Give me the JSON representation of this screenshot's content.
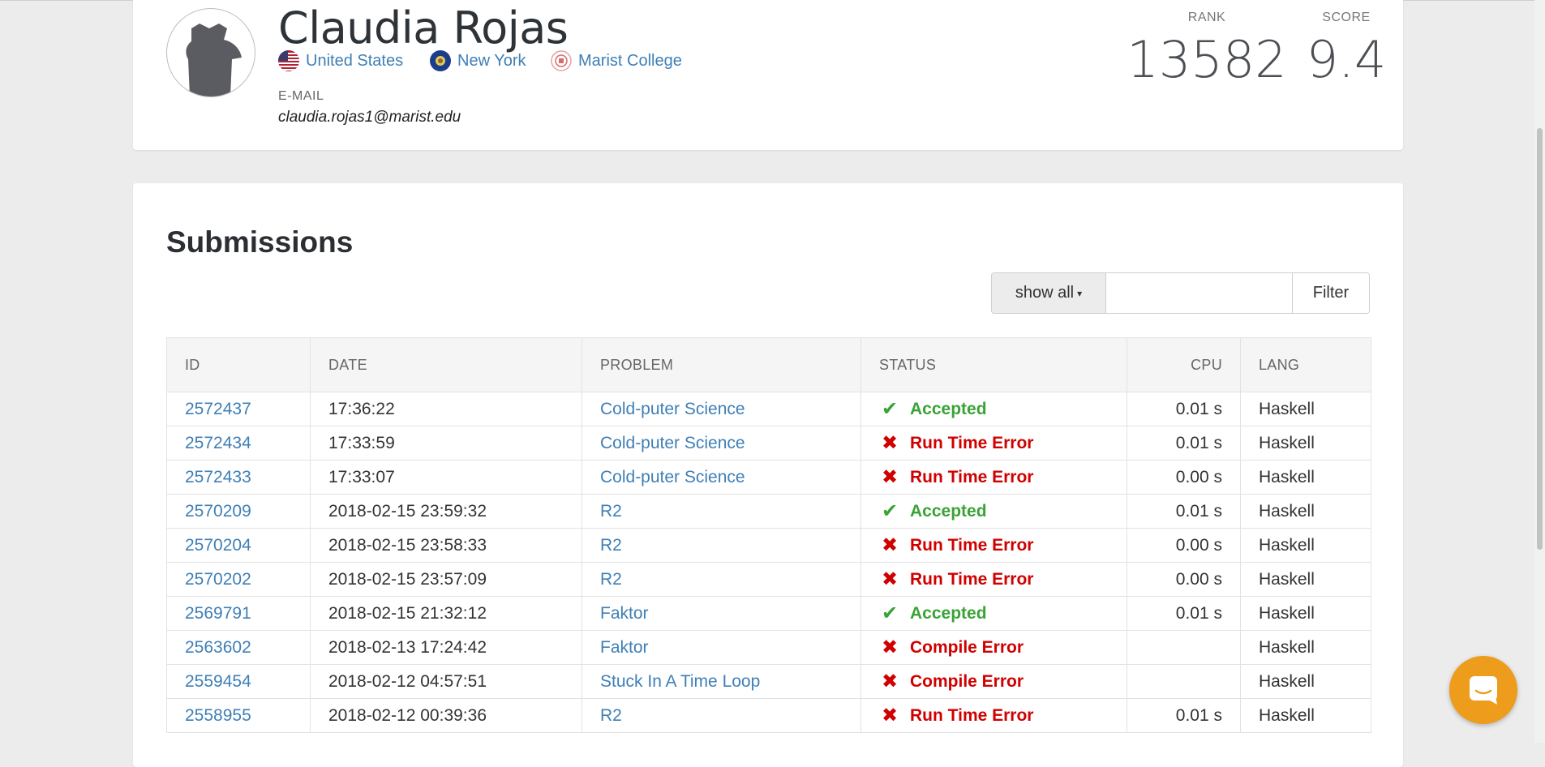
{
  "profile": {
    "name": "Claudia Rojas",
    "country": "United States",
    "state": "New York",
    "school": "Marist College",
    "email_label": "E-MAIL",
    "email": "claudia.rojas1@marist.edu",
    "rank_label": "RANK",
    "rank": "13582",
    "score_label": "SCORE",
    "score": "9.4"
  },
  "submissions": {
    "title": "Submissions",
    "filter": {
      "select_label": "show all",
      "input_value": "",
      "button_label": "Filter"
    },
    "columns": {
      "id": "ID",
      "date": "DATE",
      "problem": "PROBLEM",
      "status": "STATUS",
      "cpu": "CPU",
      "lang": "LANG"
    },
    "rows": [
      {
        "id": "2572437",
        "date": "17:36:22",
        "problem": "Cold-puter Science",
        "status": "Accepted",
        "cpu": "0.01 s",
        "lang": "Haskell"
      },
      {
        "id": "2572434",
        "date": "17:33:59",
        "problem": "Cold-puter Science",
        "status": "Run Time Error",
        "cpu": "0.01 s",
        "lang": "Haskell"
      },
      {
        "id": "2572433",
        "date": "17:33:07",
        "problem": "Cold-puter Science",
        "status": "Run Time Error",
        "cpu": "0.00 s",
        "lang": "Haskell"
      },
      {
        "id": "2570209",
        "date": "2018-02-15 23:59:32",
        "problem": "R2",
        "status": "Accepted",
        "cpu": "0.01 s",
        "lang": "Haskell"
      },
      {
        "id": "2570204",
        "date": "2018-02-15 23:58:33",
        "problem": "R2",
        "status": "Run Time Error",
        "cpu": "0.00 s",
        "lang": "Haskell"
      },
      {
        "id": "2570202",
        "date": "2018-02-15 23:57:09",
        "problem": "R2",
        "status": "Run Time Error",
        "cpu": "0.00 s",
        "lang": "Haskell"
      },
      {
        "id": "2569791",
        "date": "2018-02-15 21:32:12",
        "problem": "Faktor",
        "status": "Accepted",
        "cpu": "0.01 s",
        "lang": "Haskell"
      },
      {
        "id": "2563602",
        "date": "2018-02-13 17:24:42",
        "problem": "Faktor",
        "status": "Compile Error",
        "cpu": "",
        "lang": "Haskell"
      },
      {
        "id": "2559454",
        "date": "2018-02-12 04:57:51",
        "problem": "Stuck In A Time Loop",
        "status": "Compile Error",
        "cpu": "",
        "lang": "Haskell"
      },
      {
        "id": "2558955",
        "date": "2018-02-12 00:39:36",
        "problem": "R2",
        "status": "Run Time Error",
        "cpu": "0.01 s",
        "lang": "Haskell"
      }
    ]
  },
  "colors": {
    "link": "#3f7fb6",
    "accepted": "#3aa336",
    "error": "#d10000",
    "chat": "#ed9c1c"
  },
  "icons": {
    "accepted": "check-icon",
    "error": "cross-icon",
    "chat": "chat-icon"
  }
}
